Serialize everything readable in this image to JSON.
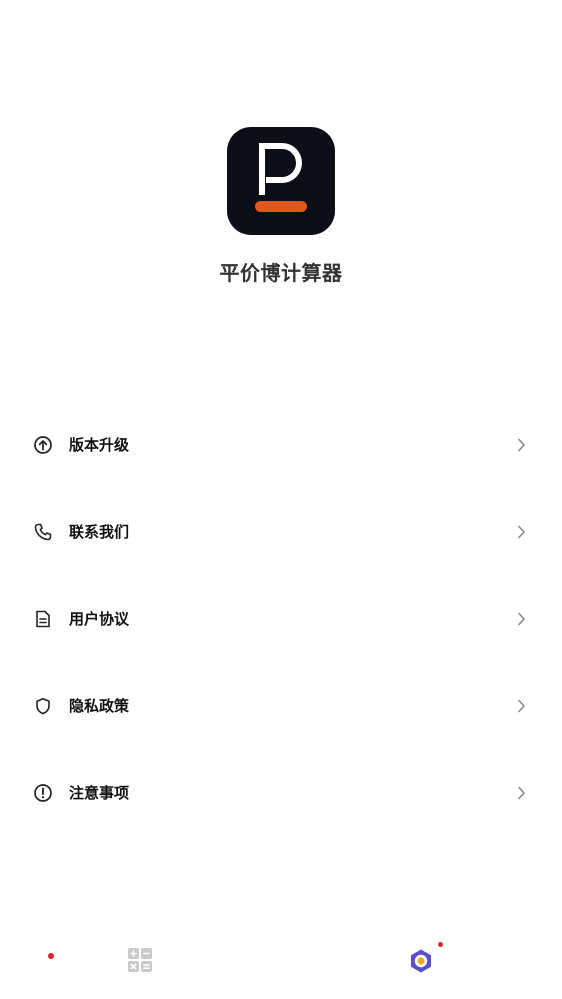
{
  "app": {
    "name": "平价博计算器",
    "logo_letter": "P",
    "logo_bg_color": "#0c0f18",
    "logo_accent_color": "#e2581c"
  },
  "menu": {
    "items": [
      {
        "label": "版本升级",
        "icon": "arrow-up-circle-icon"
      },
      {
        "label": "联系我们",
        "icon": "phone-icon"
      },
      {
        "label": "用户协议",
        "icon": "document-icon"
      },
      {
        "label": "隐私政策",
        "icon": "shield-icon",
        "badge_dot": true
      },
      {
        "label": "注意事项",
        "icon": "exclamation-circle-icon"
      }
    ]
  },
  "tabbar": {
    "tabs": [
      {
        "icon": "calculator-grid-icon",
        "active": false
      },
      {
        "icon": "hexagon-profile-icon",
        "active": true,
        "badge_dot": true
      }
    ],
    "active_color": "#5b4fc9",
    "inactive_color": "#c9c9c9",
    "badge_color": "#d6262e"
  }
}
